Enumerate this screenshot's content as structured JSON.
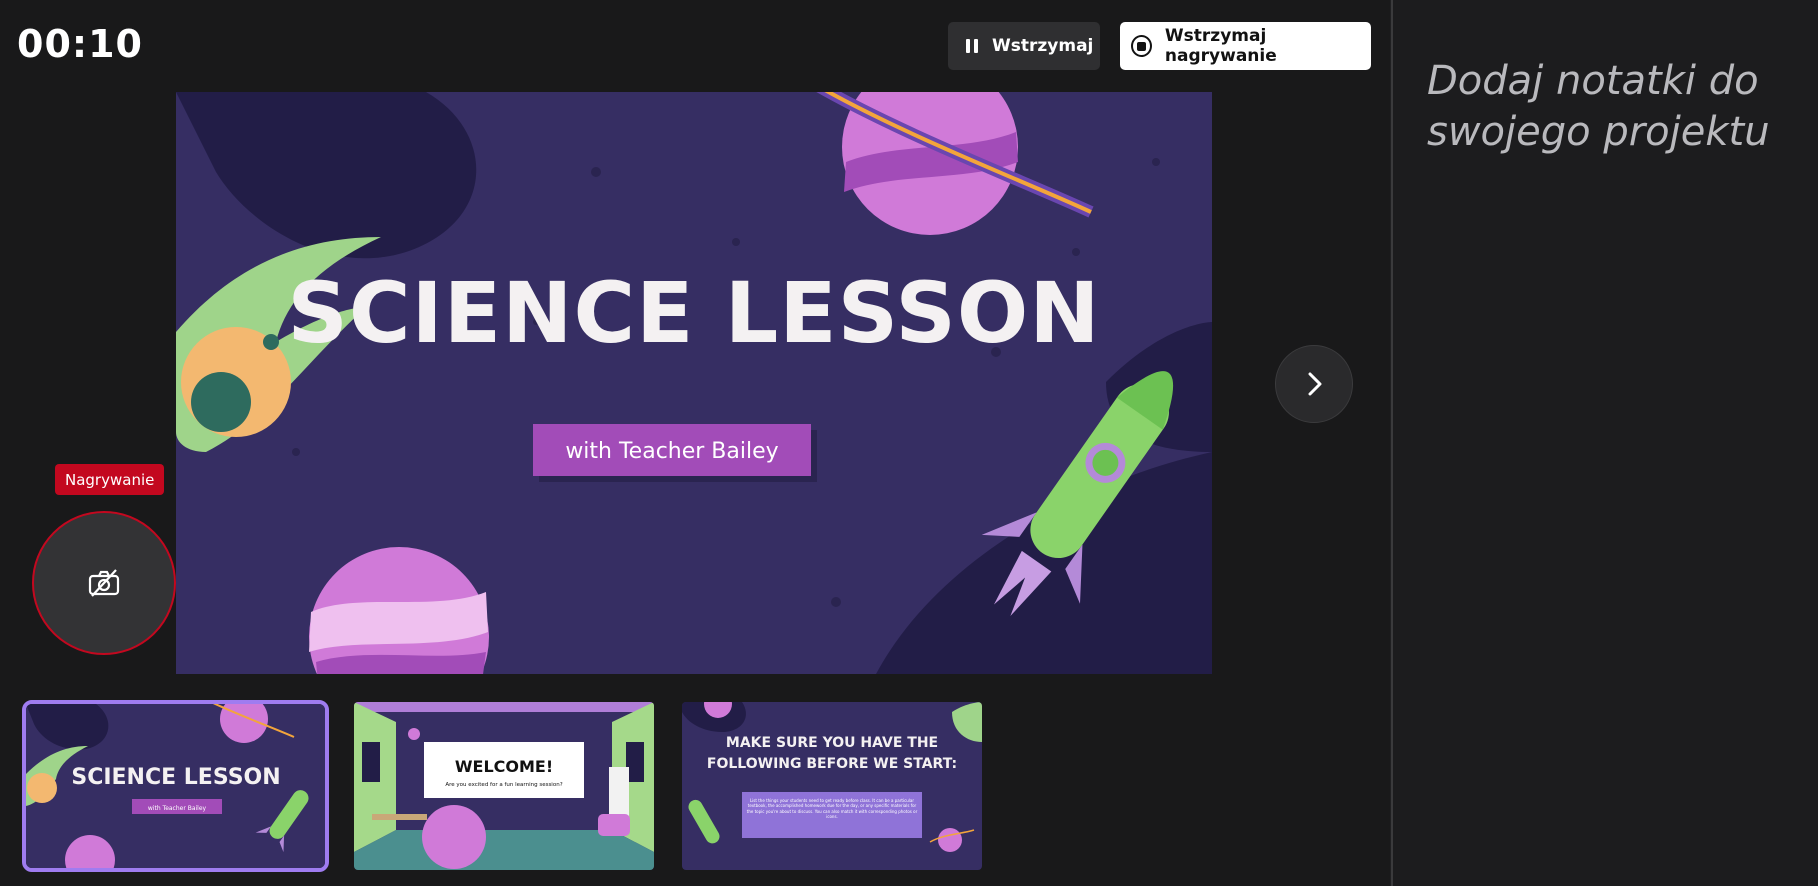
{
  "timer": "00:10",
  "toolbar": {
    "pause_label": "Wstrzymaj",
    "stop_label": "Wstrzymaj nagrywanie"
  },
  "recording": {
    "badge": "Nagrywanie",
    "camera_icon": "camera-off-icon"
  },
  "notes": {
    "placeholder": "Dodaj notatki do swojego projektu"
  },
  "slide": {
    "title": "SCIENCE LESSON",
    "subtitle": "with Teacher Bailey"
  },
  "thumbnails": [
    {
      "title": "SCIENCE LESSON",
      "subtitle": "with Teacher Bailey"
    },
    {
      "title": "WELCOME!",
      "subtitle": "Are you excited for a fun learning session?"
    },
    {
      "title_line1": "MAKE SURE YOU HAVE THE",
      "title_line2": "FOLLOWING BEFORE WE START:",
      "body": "List the things your students need to get ready before class. It can be a particular textbook, the accomplished homework due for the day, or any specific materials for the topic you're about to discuss. You can also match it with corresponding photos or icons."
    }
  ],
  "colors": {
    "slide_bg": "#362e63",
    "accent_purple": "#a24cb8",
    "record_red": "#c3081f",
    "thumb_selected": "#9f7cf0"
  }
}
